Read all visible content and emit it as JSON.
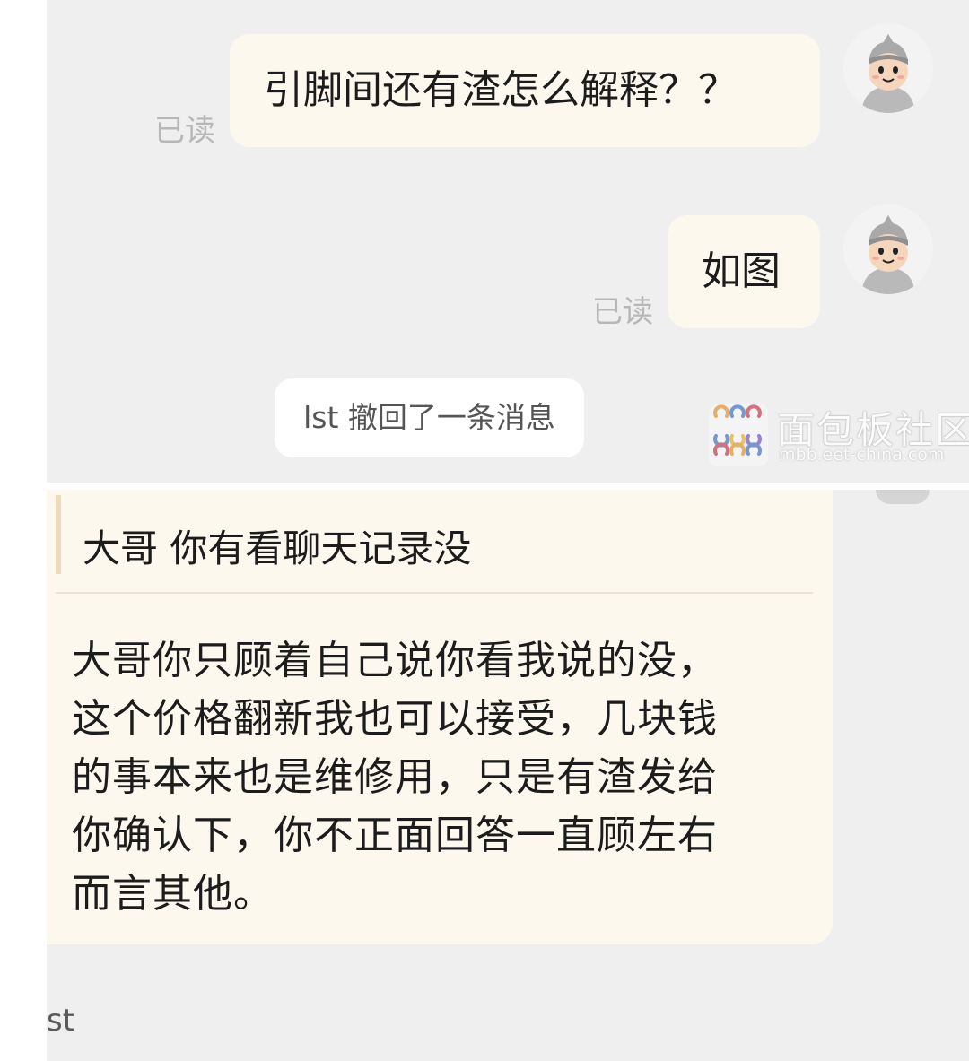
{
  "messages": [
    {
      "text": "引脚间还有渣怎么解释？？",
      "status": "已读"
    },
    {
      "text": "如图",
      "status": "已读"
    }
  ],
  "system_notice": "lst 撤回了一条消息",
  "watermark": {
    "title": "面包板社区",
    "subtitle": "mbb.eet-china.com"
  },
  "reply": {
    "quote": "大哥 你有看聊天记录没",
    "lines": [
      "大哥你只顾着自己说你看我说的没，",
      "这个价格翻新我也可以接受，几块钱",
      "的事本来也是维修用，只是有渣发给",
      "你确认下，你不正面回答一直顾左右",
      "而言其他。"
    ]
  },
  "next_sender": "st",
  "colors": {
    "chat_background": "#efeff0",
    "bubble": "#fdf8ee",
    "read_status": "#b7b7b7",
    "system_notice_bg": "#ffffff"
  },
  "icons": [
    "avatar-cartoon-icon",
    "watermark-logo-icon"
  ]
}
